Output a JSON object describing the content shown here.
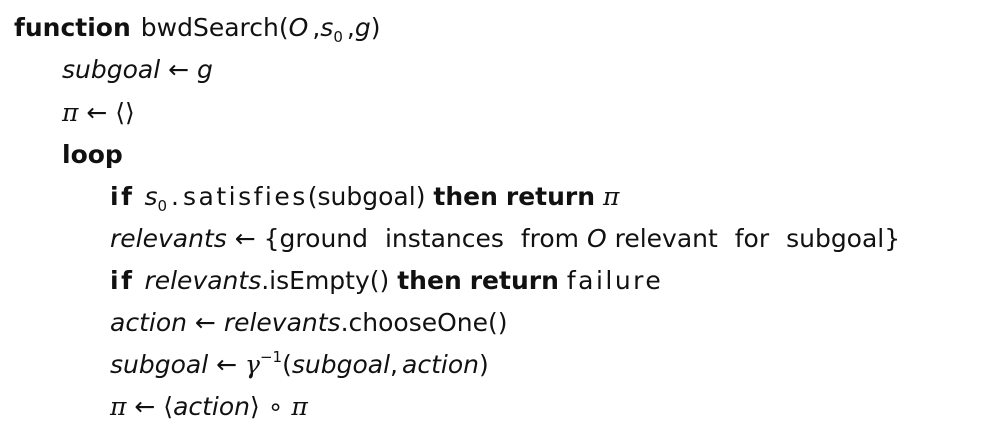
{
  "algorithm": {
    "function_kw": "function",
    "fn_name": "bwdSearch",
    "open_paren": "(",
    "param_O": "O",
    "comma": ",",
    "param_s": "s",
    "param_s_sub": "0",
    "param_g": "g",
    "close_paren": ")",
    "line1": {
      "lhs": "subgoal",
      "arrow": "←",
      "rhs": "g"
    },
    "line2": {
      "lhs": "π",
      "arrow": "←",
      "rhs": "⟨⟩"
    },
    "loop_kw": "loop",
    "line4": {
      "if_kw": "if",
      "s": "s",
      "s_sub": "0",
      "dot": ".",
      "method": "satisfies",
      "arg": "(subgoal)",
      "then_kw": "then",
      "return_kw": "return",
      "value": "π"
    },
    "line5": {
      "lhs": "relevants",
      "arrow": "←",
      "open": "{ground instances from",
      "O": "O",
      "close": "relevant for subgoal}"
    },
    "line6": {
      "if_kw": "if",
      "obj": "relevants",
      "call": ".isEmpty()",
      "then_kw": "then",
      "return_kw": "return",
      "value": "failure"
    },
    "line7": {
      "lhs": "action",
      "arrow": "←",
      "obj": "relevants",
      "call": ".chooseOne()"
    },
    "line8": {
      "lhs": "subgoal",
      "arrow": "←",
      "gamma": "γ",
      "sup": "−1",
      "open": "(",
      "arg1": "subgoal",
      "comma": ",",
      "arg2": "action",
      "close": ")"
    },
    "line9": {
      "lhs": "π",
      "arrow": "←",
      "langle": "⟨",
      "arg": "action",
      "rangle": "⟩",
      "compose": "∘",
      "rhs": "π"
    }
  }
}
